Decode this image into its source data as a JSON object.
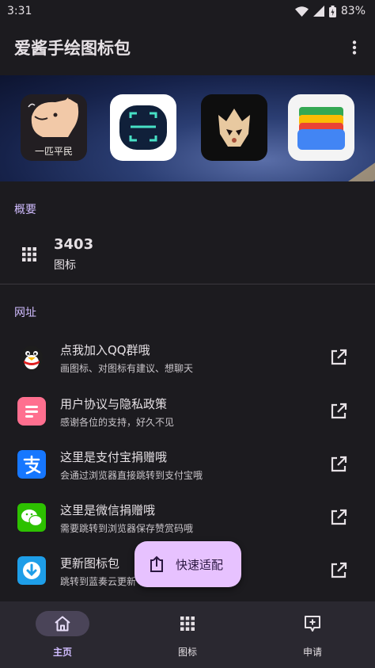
{
  "status_bar": {
    "time": "3:31",
    "battery": "83%"
  },
  "app_bar": {
    "title": "爱酱手绘图标包",
    "menu_icon": "more-vert-icon"
  },
  "banner": {
    "tiles": [
      {
        "name": "doodle-dog-icon",
        "caption": "一匹平民"
      },
      {
        "name": "scanner-app-icon"
      },
      {
        "name": "mask-app-icon"
      },
      {
        "name": "wallet-app-icon"
      }
    ]
  },
  "overview": {
    "section_title": "概要",
    "icon_count": "3403",
    "icon_count_label": "图标"
  },
  "links": {
    "section_title": "网址",
    "items": [
      {
        "title": "点我加入QQ群哦",
        "subtitle": "画图标、对图标有建议、想聊天",
        "icon": "qq-penguin-icon"
      },
      {
        "title": "用户协议与隐私政策",
        "subtitle": "感谢各位的支持，好久不见",
        "icon": "document-icon"
      },
      {
        "title": "这里是支付宝捐赠哦",
        "subtitle": "会通过浏览器直接跳转到支付宝哦",
        "icon": "alipay-icon"
      },
      {
        "title": "这里是微信捐赠哦",
        "subtitle": "需要跳转到浏览器保存赞赏码哦",
        "icon": "wechat-icon"
      },
      {
        "title": "更新图标包",
        "subtitle": "跳转到蓝奏云更新",
        "icon": "download-icon"
      }
    ]
  },
  "fab": {
    "label": "快速适配",
    "icon": "share-adapt-icon"
  },
  "bottom_nav": {
    "items": [
      {
        "label": "主页",
        "icon": "home-icon",
        "active": true
      },
      {
        "label": "图标",
        "icon": "apps-grid-icon",
        "active": false
      },
      {
        "label": "申请",
        "icon": "add-comment-icon",
        "active": false
      }
    ]
  },
  "colors": {
    "background": "#1c1b1f",
    "accent": "#d0bcff",
    "fab": "#e7c2ff",
    "nav_bg": "#2a2830"
  }
}
